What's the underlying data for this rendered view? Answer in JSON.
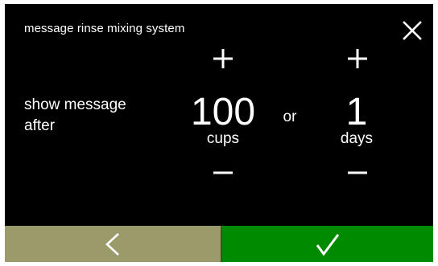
{
  "header": {
    "title": "message rinse mixing system",
    "close_icon": "close-icon"
  },
  "setting": {
    "label": "show message after",
    "or_label": "or"
  },
  "cups": {
    "value": "100",
    "unit": "cups"
  },
  "days": {
    "value": "1",
    "unit": "days"
  },
  "footer": {
    "back_icon": "chevron-left-icon",
    "confirm_icon": "checkmark-icon"
  },
  "colors": {
    "background": "#000000",
    "text": "#ffffff",
    "back_button": "#9a9a6a",
    "confirm_button": "#008a00"
  }
}
